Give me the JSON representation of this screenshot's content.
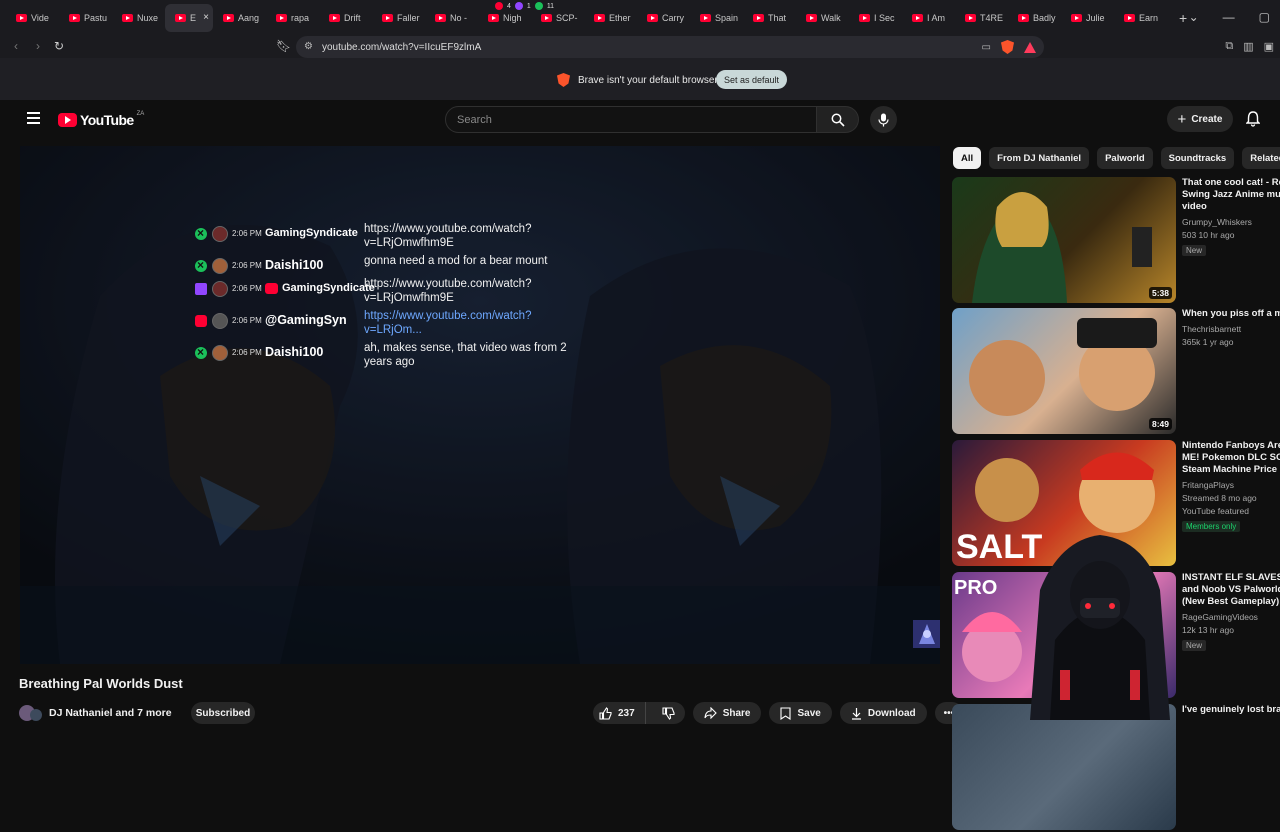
{
  "browser": {
    "tabs": [
      {
        "label": "Vide"
      },
      {
        "label": "Pastu"
      },
      {
        "label": "Nuxe"
      },
      {
        "label": "E",
        "active": true
      },
      {
        "label": "Aang"
      },
      {
        "label": "rapa"
      },
      {
        "label": "Drift"
      },
      {
        "label": "Faller"
      },
      {
        "label": "No -"
      },
      {
        "label": "Nigh"
      },
      {
        "label": "SCP-"
      },
      {
        "label": "Ether"
      },
      {
        "label": "Carry"
      },
      {
        "label": "Spain"
      },
      {
        "label": "That"
      },
      {
        "label": "Walk"
      },
      {
        "label": "I Sec"
      },
      {
        "label": "I Am"
      },
      {
        "label": "T4RE"
      },
      {
        "label": "Badly"
      },
      {
        "label": "Julie"
      },
      {
        "label": "Earn"
      }
    ],
    "badges": {
      "red": "4",
      "twitch": "1",
      "green": "11"
    },
    "url": "youtube.com/watch?v=IIcuEF9zlmA",
    "infobar": {
      "message": "Brave isn't your default browser",
      "button": "Set as default"
    }
  },
  "masthead": {
    "logo_text": "YouTube",
    "country": "ZA",
    "search_placeholder": "Search",
    "create_label": "Create"
  },
  "chat": [
    {
      "source": "xbox",
      "time": "2:06 PM",
      "user": "GamingSyndicate",
      "big": false,
      "text": "https://www.youtube.com/watch?v=LRjOmwfhm9E",
      "link": false
    },
    {
      "source": "xbox",
      "time": "2:06 PM",
      "user": "Daishi100",
      "big": true,
      "text": "gonna need a mod for a bear mount",
      "link": false
    },
    {
      "source": "twitch",
      "time": "2:06 PM",
      "user": "GamingSyndicate",
      "big": false,
      "text": "https://www.youtube.com/watch?v=LRjOmwfhm9E",
      "link": false
    },
    {
      "source": "youtube",
      "time": "2:06 PM",
      "user": "@GamingSyn",
      "big": true,
      "text": "https://www.youtube.com/watch?v=LRjOm...",
      "link": true
    },
    {
      "source": "xbox",
      "time": "2:06 PM",
      "user": "Daishi100",
      "big": true,
      "text": "ah, makes sense, that video was from 2 years ago",
      "link": false
    }
  ],
  "video": {
    "title": "Breathing Pal Worlds Dust",
    "channel": "DJ Nathaniel and 7 more",
    "subscribe_label": "Subscribed",
    "likes": "237",
    "share_label": "Share",
    "save_label": "Save",
    "download_label": "Download"
  },
  "chips": [
    "All",
    "From DJ Nathaniel",
    "Palworld",
    "Soundtracks",
    "Related"
  ],
  "recommendations": [
    {
      "title1": "That one cool cat! - Re",
      "title2": "Swing Jazz Anime mus",
      "title3": "video",
      "channel": "Grumpy_Whiskers",
      "meta": "503   10 hr ago",
      "badge": "New",
      "duration": "5:38"
    },
    {
      "title1": "When you piss off a ma",
      "title2": "",
      "title3": "",
      "channel": "Thechrisbarnett",
      "meta": "365k   1 yr ago",
      "badge": "",
      "duration": "8:49"
    },
    {
      "title1": "Nintendo Fanboys Are",
      "title2": "ME! Pokemon DLC SCA",
      "title3": "Steam Machine Price F",
      "channel": "FritangaPlays",
      "meta": "Streamed 8 mo ago",
      "featured": "YouTube featured",
      "members": "Members only",
      "duration": ""
    },
    {
      "title1": "INSTANT ELF SLAVES",
      "title2": "and Noob VS Palworld",
      "title3": "(New Best Gameplay)",
      "channel": "RageGamingVideos",
      "meta": "12k   13 hr ago",
      "badge": "New",
      "duration": ""
    },
    {
      "title1": "I've genuinely lost brai",
      "title2": "",
      "title3": "",
      "channel": "",
      "meta": "",
      "badge": "",
      "duration": ""
    }
  ],
  "colors": {
    "bg": "#0f0f0f",
    "accent": "#ff0033",
    "link": "#6ea8ff",
    "xbox": "#1bc05a",
    "twitch": "#9146ff"
  }
}
